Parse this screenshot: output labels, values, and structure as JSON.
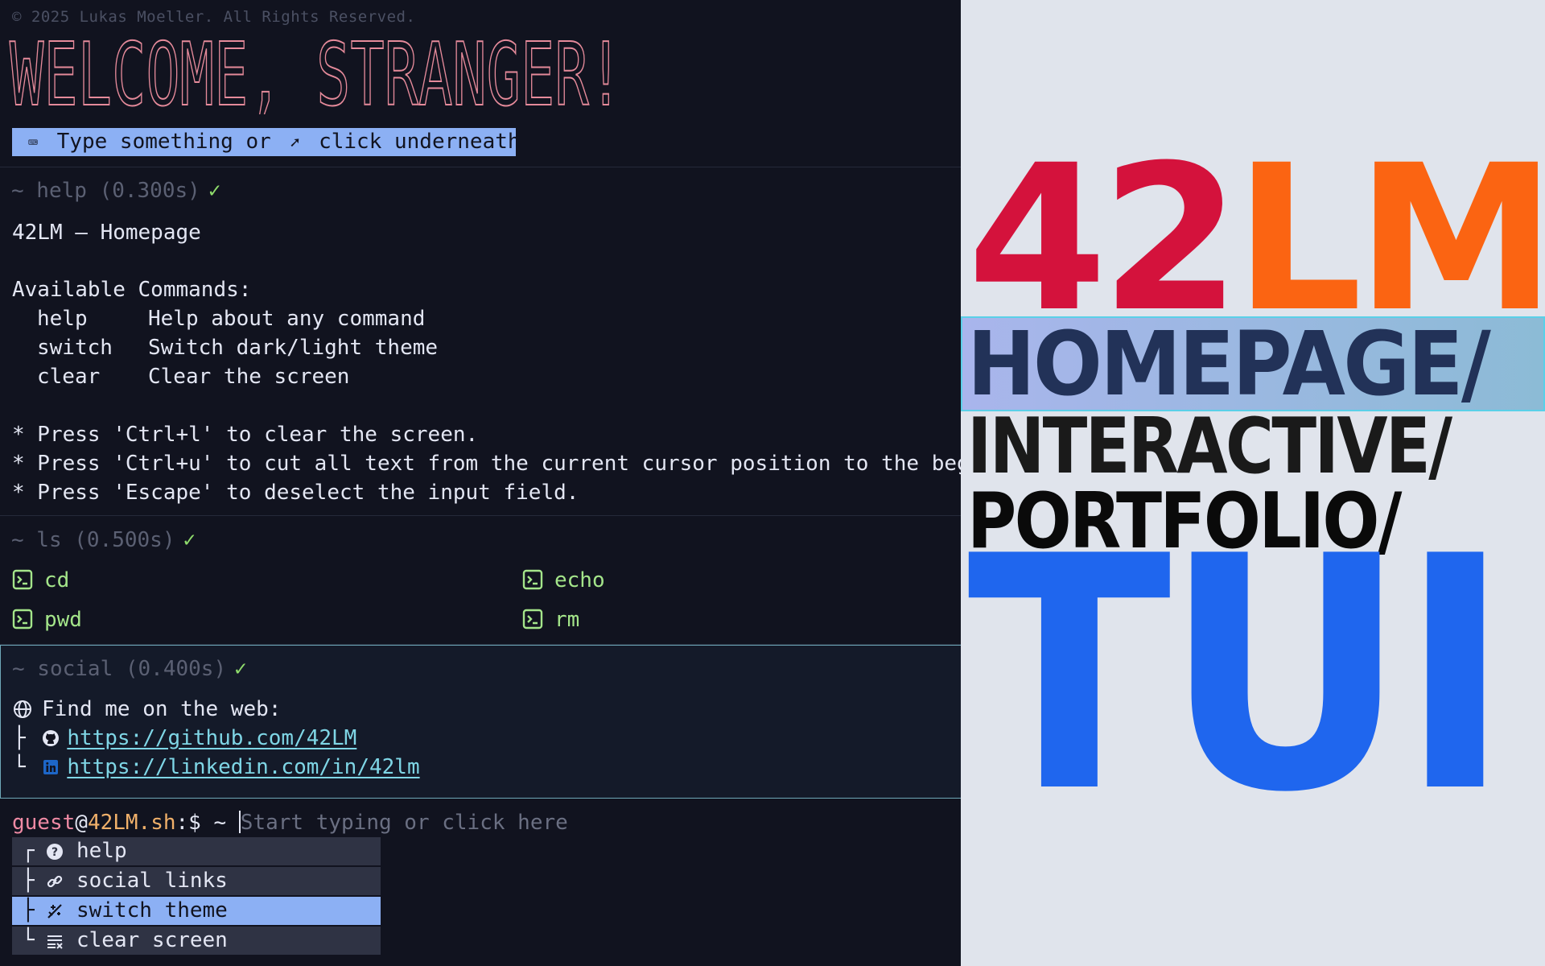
{
  "copyright": "© 2025 Lukas Moeller. All Rights Reserved.",
  "banner_text": "WELCOME, STRANGER!",
  "hint": {
    "keyboard_icon": "keyboard-icon",
    "pre": "Type something or",
    "pointer_icon": "pointer-click-icon",
    "post": "click underneath"
  },
  "help_block": {
    "header": "~ help (0.300s)",
    "status": "✓",
    "title": "42LM – Homepage",
    "available": "Available Commands:",
    "commands": [
      {
        "name": "help",
        "desc": "Help about any command"
      },
      {
        "name": "switch",
        "desc": "Switch dark/light theme"
      },
      {
        "name": "clear",
        "desc": "Clear the screen"
      }
    ],
    "tips": [
      "* Press 'Ctrl+l' to clear the screen.",
      "* Press 'Ctrl+u' to cut all text from the current cursor position to the begi",
      "* Press 'Escape' to deselect the input field."
    ]
  },
  "ls_block": {
    "header": "~ ls (0.500s)",
    "status": "✓",
    "items": [
      "cd",
      "echo",
      "pwd",
      "rm"
    ]
  },
  "social_block": {
    "header": "~ social (0.400s)",
    "status": "✓",
    "intro": "Find me on the web:",
    "links": [
      {
        "branch": "├",
        "icon": "github-icon",
        "url": "https://github.com/42LM"
      },
      {
        "branch": "└",
        "icon": "linkedin-icon",
        "url": "https://linkedin.com/in/42lm"
      }
    ]
  },
  "prompt": {
    "user": "guest",
    "at": "@",
    "host": "42LM.sh",
    "symbol": ":$ ~ ",
    "placeholder": "Start typing or click here"
  },
  "menu": [
    {
      "branch": "┌",
      "icon": "help-circle-icon",
      "label": "help",
      "selected": false
    },
    {
      "branch": "├",
      "icon": "link-icon",
      "label": "social links",
      "selected": false
    },
    {
      "branch": "├",
      "icon": "theme-switch-icon",
      "label": "switch theme",
      "selected": true
    },
    {
      "branch": "└",
      "icon": "clear-lines-icon",
      "label": "clear screen",
      "selected": false
    }
  ],
  "poster": {
    "line1_a": "42",
    "line1_b": "LM",
    "line2": "HOMEPAGE/",
    "line3": "INTERACTIVE/",
    "line4": "PORTFOLIO/",
    "line5": "TUI"
  },
  "colors": {
    "terminal_bg": "#11131f",
    "accent_blue": "#8cb0f4",
    "ok_green": "#8fdc6c",
    "red": "#d4123c",
    "orange": "#fb6412",
    "tui_blue": "#1f66ee"
  }
}
